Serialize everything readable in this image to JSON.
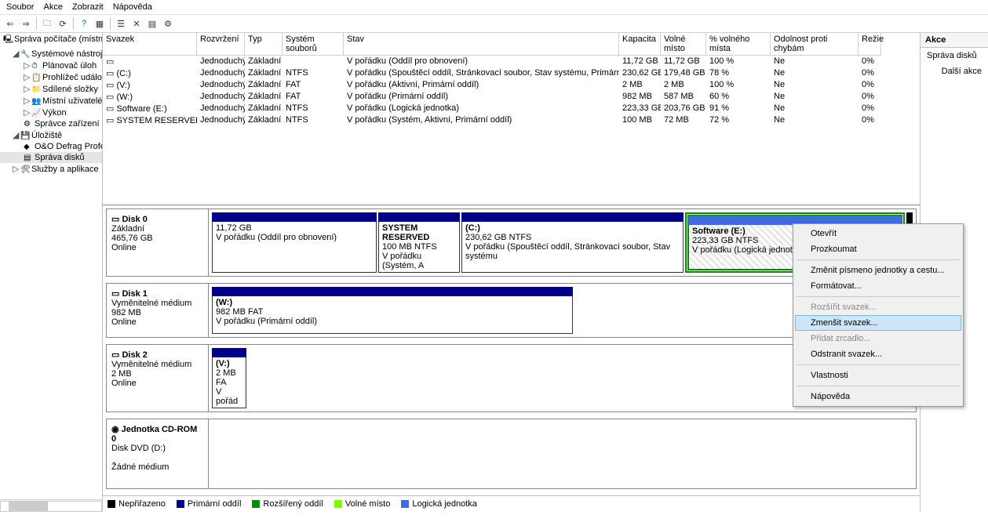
{
  "menu": {
    "file": "Soubor",
    "action": "Akce",
    "view": "Zobrazit",
    "help": "Nápověda"
  },
  "tree": {
    "root": "Správa počítače (místní)",
    "systools": "Systémové nástroje",
    "sched": "Plánovač úloh",
    "events": "Prohlížeč událostí",
    "shared": "Sdílené složky",
    "users": "Místní uživatelé a s",
    "perf": "Výkon",
    "devmgr": "Správce zařízení",
    "storage": "Úložiště",
    "defrag": "O&O Defrag Profe",
    "diskmgmt": "Správa disků",
    "services": "Služby a aplikace"
  },
  "cols": {
    "vol": "Svazek",
    "lay": "Rozvržení",
    "typ": "Typ",
    "fs": "Systém souborů",
    "stat": "Stav",
    "cap": "Kapacita",
    "free": "Volné místo",
    "pct": "% volného místa",
    "fault": "Odolnost proti chybám",
    "over": "Režie"
  },
  "rows": [
    {
      "vol": "",
      "lay": "Jednoduchý",
      "typ": "Základní",
      "fs": "",
      "stat": "V pořádku (Oddíl pro obnovení)",
      "cap": "11,72 GB",
      "free": "11,72 GB",
      "pct": "100 %",
      "fault": "Ne",
      "over": "0%"
    },
    {
      "vol": "(C:)",
      "lay": "Jednoduchý",
      "typ": "Základní",
      "fs": "NTFS",
      "stat": "V pořádku (Spouštěcí oddíl, Stránkovací soubor, Stav systému, Primární oddíl)",
      "cap": "230,62 GB",
      "free": "179,48 GB",
      "pct": "78 %",
      "fault": "Ne",
      "over": "0%"
    },
    {
      "vol": "(V:)",
      "lay": "Jednoduchý",
      "typ": "Základní",
      "fs": "FAT",
      "stat": "V pořádku (Aktivní, Primární oddíl)",
      "cap": "2 MB",
      "free": "2 MB",
      "pct": "100 %",
      "fault": "Ne",
      "over": "0%"
    },
    {
      "vol": "(W:)",
      "lay": "Jednoduchý",
      "typ": "Základní",
      "fs": "FAT",
      "stat": "V pořádku (Primární oddíl)",
      "cap": "982 MB",
      "free": "587 MB",
      "pct": "60 %",
      "fault": "Ne",
      "over": "0%"
    },
    {
      "vol": "Software (E:)",
      "lay": "Jednoduchý",
      "typ": "Základní",
      "fs": "NTFS",
      "stat": "V pořádku (Logická jednotka)",
      "cap": "223,33 GB",
      "free": "203,76 GB",
      "pct": "91 %",
      "fault": "Ne",
      "over": "0%"
    },
    {
      "vol": "SYSTEM RESERVED (I:)",
      "lay": "Jednoduchý",
      "typ": "Základní",
      "fs": "NTFS",
      "stat": "V pořádku (Systém, Aktivní, Primární oddíl)",
      "cap": "100 MB",
      "free": "72 MB",
      "pct": "72 %",
      "fault": "Ne",
      "over": "0%"
    }
  ],
  "disks": {
    "d0": {
      "name": "Disk 0",
      "type": "Základní",
      "size": "465,76 GB",
      "status": "Online"
    },
    "d1": {
      "name": "Disk 1",
      "type": "Vyměnitelné médium",
      "size": "982 MB",
      "status": "Online"
    },
    "d2": {
      "name": "Disk 2",
      "type": "Vyměnitelné médium",
      "size": "2 MB",
      "status": "Online"
    },
    "cd": {
      "name": "Jednotka CD-ROM 0",
      "type": "Disk DVD (D:)",
      "status": "Žádné médium"
    }
  },
  "parts": {
    "p0a": {
      "name": "",
      "size": "11,72 GB",
      "stat": "V pořádku (Oddíl pro obnovení)"
    },
    "p0b": {
      "name": "SYSTEM RESERVED",
      "size": "100 MB NTFS",
      "stat": "V pořádku (Systém, A"
    },
    "p0c": {
      "name": "(C:)",
      "size": "230,62 GB NTFS",
      "stat": "V pořádku (Spouštěcí oddíl, Stránkovací soubor, Stav systému"
    },
    "p0d": {
      "name": "Software  (E:)",
      "size": "223,33 GB NTFS",
      "stat": "V pořádku (Logická jednotka)"
    },
    "p1a": {
      "name": "(W:)",
      "size": "982 MB FAT",
      "stat": "V pořádku (Primární oddíl)"
    },
    "p2a": {
      "name": "(V:)",
      "size": "2 MB FA",
      "stat": "V pořád"
    }
  },
  "legend": {
    "un": "Nepřiřazeno",
    "pri": "Primární oddíl",
    "ext": "Rozšířený oddíl",
    "free": "Volné místo",
    "log": "Logická jednotka"
  },
  "actions": {
    "title": "Akce",
    "disk": "Správa disků",
    "more": "Další akce"
  },
  "ctx": {
    "open": "Otevřít",
    "explore": "Prozkoumat",
    "change": "Změnit písmeno jednotky a cestu...",
    "format": "Formátovat...",
    "extend": "Rozšířit svazek...",
    "shrink": "Zmenšit svazek...",
    "mirror": "Přidat zrcadlo...",
    "delete": "Odstranit svazek...",
    "props": "Vlastnosti",
    "help": "Nápověda"
  }
}
